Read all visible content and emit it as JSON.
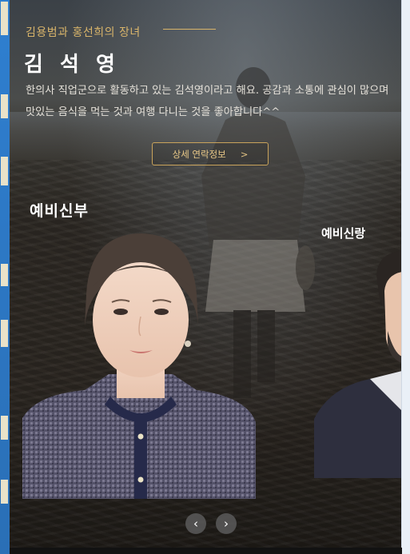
{
  "profile": {
    "subtitle": "김용범과 홍선희의 장녀",
    "name": "김 석 영",
    "intro": "한의사 직업군으로 활동하고 있는 김석영이라고 해요. 공감과 소통에 관심이 많으며 맛있는 음식을 먹는 것과 여행 다니는 것을 좋아합니다^^",
    "contact_button": "상세 연락정보",
    "contact_arrow": ">"
  },
  "carousel": {
    "bride_label": "예비신부",
    "groom_label": "예비신랑",
    "prev_icon": "‹",
    "next_icon": "›"
  },
  "colors": {
    "accent_gold": "#d8b46a",
    "background": "#2a2520",
    "text": "#e6e2da"
  },
  "icons": [
    "chevron-left-icon",
    "chevron-right-icon"
  ]
}
